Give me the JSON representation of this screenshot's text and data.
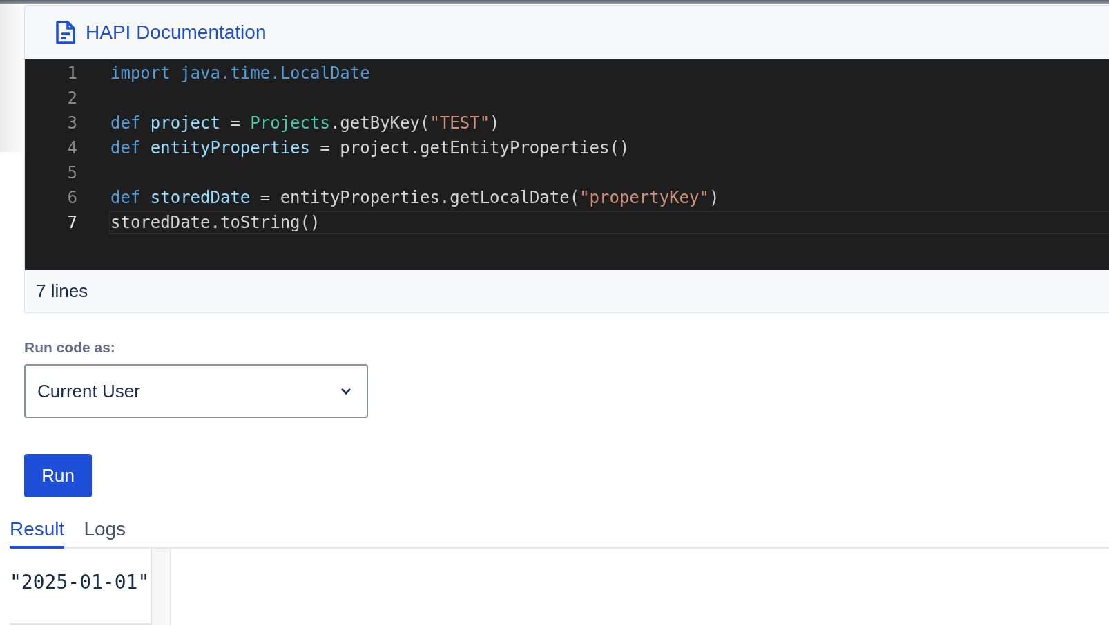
{
  "doc_link": {
    "label": "HAPI Documentation"
  },
  "editor": {
    "lines": [
      {
        "number": "1",
        "active": false,
        "tokens": [
          {
            "kind": "keyword",
            "text": "import "
          },
          {
            "kind": "keyword",
            "text": "java.time.LocalDate"
          }
        ]
      },
      {
        "number": "2",
        "active": false
      },
      {
        "number": "3",
        "active": false,
        "tokens": [
          {
            "kind": "keyword",
            "text": "def "
          },
          {
            "kind": "ident",
            "text": "project"
          },
          {
            "kind": "plain",
            "text": " = "
          },
          {
            "kind": "type",
            "text": "Projects"
          },
          {
            "kind": "plain",
            "text": ".getByKey("
          },
          {
            "kind": "string",
            "text": "\"TEST\""
          },
          {
            "kind": "plain",
            "text": ")"
          }
        ]
      },
      {
        "number": "4",
        "active": false,
        "tokens": [
          {
            "kind": "keyword",
            "text": "def "
          },
          {
            "kind": "ident",
            "text": "entityProperties"
          },
          {
            "kind": "plain",
            "text": " = project.getEntityProperties()"
          }
        ]
      },
      {
        "number": "5",
        "active": false
      },
      {
        "number": "6",
        "active": false,
        "tokens": [
          {
            "kind": "keyword",
            "text": "def "
          },
          {
            "kind": "ident",
            "text": "storedDate"
          },
          {
            "kind": "plain",
            "text": " = entityProperties.getLocalDate("
          },
          {
            "kind": "string",
            "text": "\"propertyKey\""
          },
          {
            "kind": "plain",
            "text": ")"
          }
        ]
      },
      {
        "number": "7",
        "active": true,
        "tokens": [
          {
            "kind": "plain",
            "text": "storedDate.toString()"
          }
        ]
      }
    ],
    "footer": "7 lines"
  },
  "run_as": {
    "label": "Run code as:",
    "value": "Current User"
  },
  "run_button": "Run",
  "tabs": [
    {
      "label": "Result",
      "selected": true
    },
    {
      "label": "Logs",
      "selected": false
    }
  ],
  "result": "\"2025-01-01\""
}
